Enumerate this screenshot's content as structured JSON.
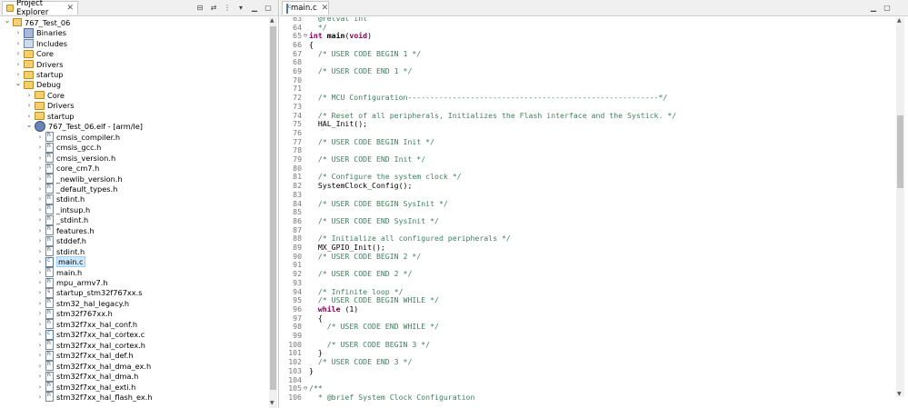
{
  "project_explorer": {
    "tab_title": "Project Explorer",
    "items": [
      {
        "label": "767_Test_06",
        "level": 0,
        "expanded": true,
        "icon": "project-icon"
      },
      {
        "label": "Binaries",
        "level": 1,
        "expanded": false,
        "icon": "binaries-icon"
      },
      {
        "label": "Includes",
        "level": 1,
        "expanded": false,
        "icon": "includes-icon"
      },
      {
        "label": "Core",
        "level": 1,
        "expanded": false,
        "icon": "folder-icon"
      },
      {
        "label": "Drivers",
        "level": 1,
        "expanded": false,
        "icon": "folder-icon"
      },
      {
        "label": "startup",
        "level": 1,
        "expanded": false,
        "icon": "folder-icon"
      },
      {
        "label": "Debug",
        "level": 1,
        "expanded": true,
        "icon": "folder-icon"
      },
      {
        "label": "Core",
        "level": 2,
        "expanded": false,
        "icon": "folder-icon"
      },
      {
        "label": "Drivers",
        "level": 2,
        "expanded": false,
        "icon": "folder-icon"
      },
      {
        "label": "startup",
        "level": 2,
        "expanded": false,
        "icon": "folder-icon"
      },
      {
        "label": "767_Test_06.elf - [arm/le]",
        "level": 2,
        "expanded": true,
        "icon": "elf-icon"
      },
      {
        "label": "cmsis_compiler.h",
        "level": 3,
        "expanded": false,
        "icon": "header-file-icon"
      },
      {
        "label": "cmsis_gcc.h",
        "level": 3,
        "expanded": false,
        "icon": "header-file-icon"
      },
      {
        "label": "cmsis_version.h",
        "level": 3,
        "expanded": false,
        "icon": "header-file-icon"
      },
      {
        "label": "core_cm7.h",
        "level": 3,
        "expanded": false,
        "icon": "header-file-icon"
      },
      {
        "label": "_newlib_version.h",
        "level": 3,
        "expanded": false,
        "icon": "header-file-icon"
      },
      {
        "label": "_default_types.h",
        "level": 3,
        "expanded": false,
        "icon": "header-file-icon"
      },
      {
        "label": "stdint.h",
        "level": 3,
        "expanded": false,
        "icon": "header-file-icon"
      },
      {
        "label": "_intsup.h",
        "level": 3,
        "expanded": false,
        "icon": "header-file-icon"
      },
      {
        "label": "_stdint.h",
        "level": 3,
        "expanded": false,
        "icon": "header-file-icon"
      },
      {
        "label": "features.h",
        "level": 3,
        "expanded": false,
        "icon": "header-file-icon"
      },
      {
        "label": "stddef.h",
        "level": 3,
        "expanded": false,
        "icon": "header-file-icon"
      },
      {
        "label": "stdint.h",
        "level": 3,
        "expanded": false,
        "icon": "header-file-icon"
      },
      {
        "label": "main.c",
        "level": 3,
        "expanded": false,
        "icon": "c-file-icon",
        "selected": true
      },
      {
        "label": "main.h",
        "level": 3,
        "expanded": false,
        "icon": "header-file-icon"
      },
      {
        "label": "mpu_armv7.h",
        "level": 3,
        "expanded": false,
        "icon": "header-file-icon"
      },
      {
        "label": "startup_stm32f767xx.s",
        "level": 3,
        "expanded": false,
        "icon": "asm-file-icon"
      },
      {
        "label": "stm32_hal_legacy.h",
        "level": 3,
        "expanded": false,
        "icon": "header-file-icon"
      },
      {
        "label": "stm32f767xx.h",
        "level": 3,
        "expanded": false,
        "icon": "header-file-icon"
      },
      {
        "label": "stm32f7xx_hal_conf.h",
        "level": 3,
        "expanded": false,
        "icon": "header-file-icon"
      },
      {
        "label": "stm32f7xx_hal_cortex.c",
        "level": 3,
        "expanded": false,
        "icon": "c-file-icon"
      },
      {
        "label": "stm32f7xx_hal_cortex.h",
        "level": 3,
        "expanded": false,
        "icon": "header-file-icon"
      },
      {
        "label": "stm32f7xx_hal_def.h",
        "level": 3,
        "expanded": false,
        "icon": "header-file-icon"
      },
      {
        "label": "stm32f7xx_hal_dma_ex.h",
        "level": 3,
        "expanded": false,
        "icon": "header-file-icon"
      },
      {
        "label": "stm32f7xx_hal_dma.h",
        "level": 3,
        "expanded": false,
        "icon": "header-file-icon"
      },
      {
        "label": "stm32f7xx_hal_exti.h",
        "level": 3,
        "expanded": false,
        "icon": "header-file-icon"
      },
      {
        "label": "stm32f7xx_hal_flash_ex.h",
        "level": 3,
        "expanded": false,
        "icon": "header-file-icon"
      }
    ]
  },
  "editor": {
    "tab_title": "main.c",
    "lines": [
      {
        "n": "63",
        "fold": "",
        "text": "  @retval int"
      },
      {
        "n": "64",
        "fold": "",
        "text": "  */"
      },
      {
        "n": "65",
        "fold": "⊖",
        "text": "int main(void)"
      },
      {
        "n": "66",
        "fold": "",
        "text": "{"
      },
      {
        "n": "67",
        "fold": "",
        "text": "  /* USER CODE BEGIN 1 */"
      },
      {
        "n": "68",
        "fold": "",
        "text": ""
      },
      {
        "n": "69",
        "fold": "",
        "text": "  /* USER CODE END 1 */"
      },
      {
        "n": "70",
        "fold": "",
        "text": ""
      },
      {
        "n": "71",
        "fold": "",
        "text": ""
      },
      {
        "n": "72",
        "fold": "",
        "text": "  /* MCU Configuration--------------------------------------------------------*/"
      },
      {
        "n": "73",
        "fold": "",
        "text": ""
      },
      {
        "n": "74",
        "fold": "",
        "text": "  /* Reset of all peripherals, Initializes the Flash interface and the Systick. */"
      },
      {
        "n": "75",
        "fold": "",
        "text": "  HAL_Init();"
      },
      {
        "n": "76",
        "fold": "",
        "text": ""
      },
      {
        "n": "77",
        "fold": "",
        "text": "  /* USER CODE BEGIN Init */"
      },
      {
        "n": "78",
        "fold": "",
        "text": ""
      },
      {
        "n": "79",
        "fold": "",
        "text": "  /* USER CODE END Init */"
      },
      {
        "n": "80",
        "fold": "",
        "text": ""
      },
      {
        "n": "81",
        "fold": "",
        "text": "  /* Configure the system clock */"
      },
      {
        "n": "82",
        "fold": "",
        "text": "  SystemClock_Config();"
      },
      {
        "n": "83",
        "fold": "",
        "text": ""
      },
      {
        "n": "84",
        "fold": "",
        "text": "  /* USER CODE BEGIN SysInit */"
      },
      {
        "n": "85",
        "fold": "",
        "text": ""
      },
      {
        "n": "86",
        "fold": "",
        "text": "  /* USER CODE END SysInit */"
      },
      {
        "n": "87",
        "fold": "",
        "text": ""
      },
      {
        "n": "88",
        "fold": "",
        "text": "  /* Initialize all configured peripherals */"
      },
      {
        "n": "89",
        "fold": "",
        "text": "  MX_GPIO_Init();"
      },
      {
        "n": "90",
        "fold": "",
        "text": "  /* USER CODE BEGIN 2 */"
      },
      {
        "n": "91",
        "fold": "",
        "text": ""
      },
      {
        "n": "92",
        "fold": "",
        "text": "  /* USER CODE END 2 */"
      },
      {
        "n": "93",
        "fold": "",
        "text": ""
      },
      {
        "n": "94",
        "fold": "",
        "text": "  /* Infinite loop */"
      },
      {
        "n": "95",
        "fold": "",
        "text": "  /* USER CODE BEGIN WHILE */"
      },
      {
        "n": "96",
        "fold": "",
        "text": "  while (1)"
      },
      {
        "n": "97",
        "fold": "",
        "text": "  {"
      },
      {
        "n": "98",
        "fold": "",
        "text": "    /* USER CODE END WHILE */"
      },
      {
        "n": "99",
        "fold": "",
        "text": ""
      },
      {
        "n": "100",
        "fold": "",
        "text": "    /* USER CODE BEGIN 3 */"
      },
      {
        "n": "101",
        "fold": "",
        "text": "  }"
      },
      {
        "n": "102",
        "fold": "",
        "text": "  /* USER CODE END 3 */"
      },
      {
        "n": "103",
        "fold": "",
        "text": "}"
      },
      {
        "n": "104",
        "fold": "",
        "text": ""
      },
      {
        "n": "105",
        "fold": "⊖",
        "text": "/**"
      },
      {
        "n": "106",
        "fold": "",
        "text": "  * @brief System Clock Configuration"
      }
    ]
  },
  "colors": {
    "keyword": "#7f0055",
    "comment": "#3f7f5f",
    "line_number": "#787878",
    "selection": "#cde8ff"
  }
}
